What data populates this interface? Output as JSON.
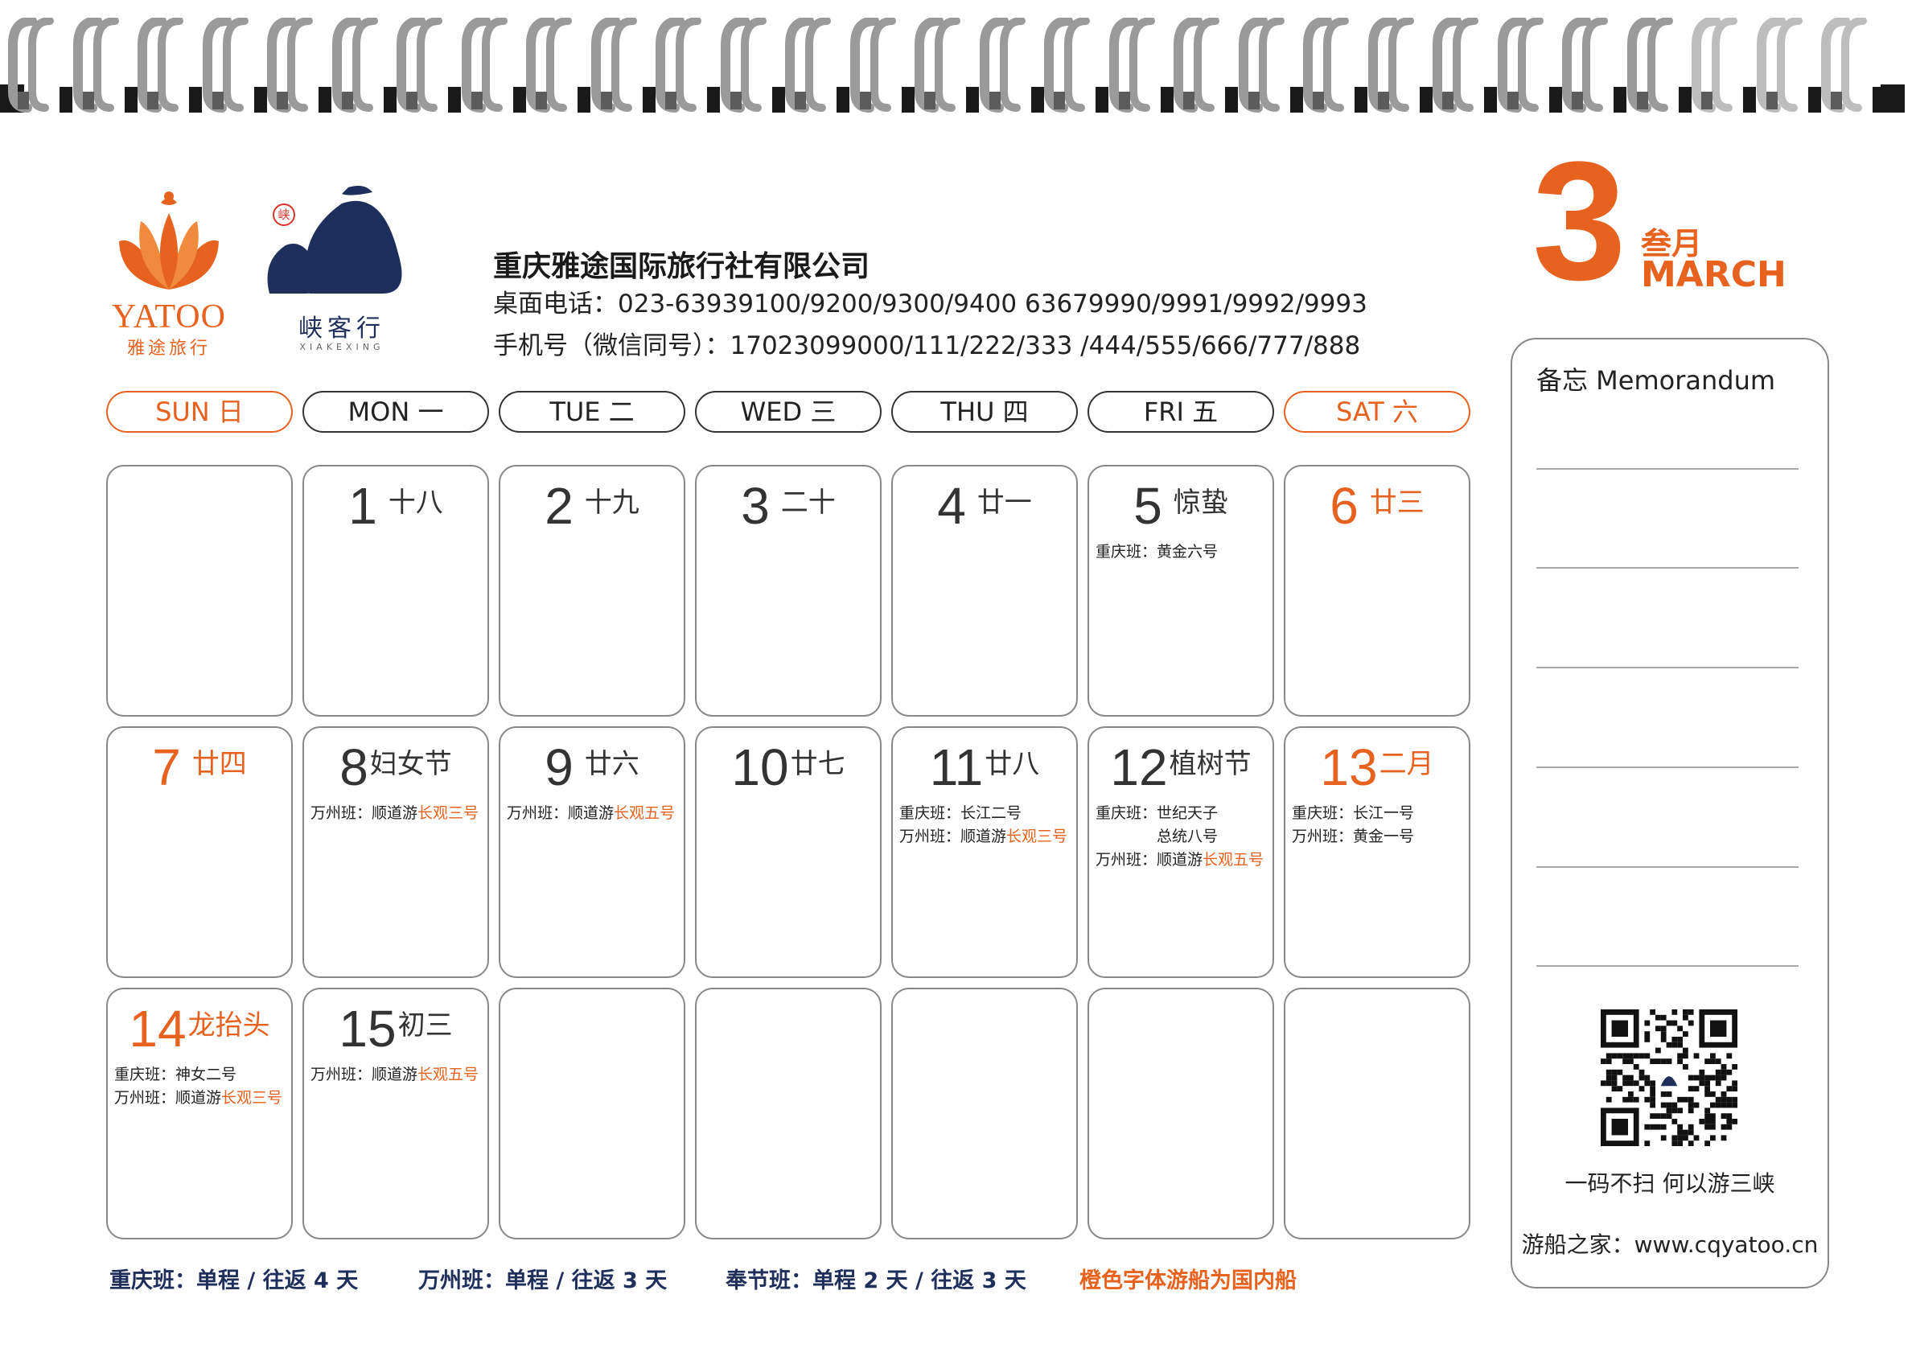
{
  "company": {
    "name": "重庆雅途国际旅行社有限公司",
    "desk_phone": "桌面电话：023-63939100/9200/9300/9400   63679990/9991/9992/9993",
    "mobile": "手机号（微信同号）：17023099000/111/222/333 /444/555/666/777/888"
  },
  "logos": {
    "yatoo_word": "YATOO",
    "yatoo_cn": "雅途旅行",
    "xk_seal": "峡",
    "xk_cn": "峡客行",
    "xk_pinyin": "XIAKEXING"
  },
  "month": {
    "number": "3",
    "cn": "叁月",
    "en": "MARCH"
  },
  "weekdays": [
    "SUN  日",
    "MON  一",
    "TUE  二",
    "WED  三",
    "THU  四",
    "FRI  五",
    "SAT 六"
  ],
  "days": [
    {
      "num": "",
      "lunar": "",
      "notes": []
    },
    {
      "num": "1",
      "lunar": "十八",
      "notes": []
    },
    {
      "num": "2",
      "lunar": "十九",
      "notes": []
    },
    {
      "num": "3",
      "lunar": "二十",
      "notes": []
    },
    {
      "num": "4",
      "lunar": "廿一",
      "notes": []
    },
    {
      "num": "5",
      "lunar": "惊蛰",
      "notes": [
        {
          "a": "重庆班：黄金六号",
          "b": ""
        }
      ]
    },
    {
      "num": "6",
      "lunar": "廿三",
      "notes": []
    },
    {
      "num": "7",
      "lunar": "廿四",
      "notes": []
    },
    {
      "num": "8",
      "lunar": "妇女节",
      "notes": [
        {
          "a": "万州班：顺道游",
          "b": "长观三号"
        }
      ]
    },
    {
      "num": "9",
      "lunar": "廿六",
      "notes": [
        {
          "a": "万州班：顺道游",
          "b": "长观五号"
        }
      ]
    },
    {
      "num": "10",
      "lunar": "廿七",
      "notes": []
    },
    {
      "num": "11",
      "lunar": "廿八",
      "notes": [
        {
          "a": "重庆班：长江二号",
          "b": ""
        },
        {
          "a": "万州班：顺道游",
          "b": "长观三号"
        }
      ]
    },
    {
      "num": "12",
      "lunar": "植树节",
      "notes": [
        {
          "a": "重庆班：世纪天子",
          "b": ""
        },
        {
          "a": "　　　　总统八号",
          "b": ""
        },
        {
          "a": "万州班：顺道游",
          "b": "长观五号"
        }
      ]
    },
    {
      "num": "13",
      "lunar": "二月",
      "notes": [
        {
          "a": "重庆班：长江一号",
          "b": ""
        },
        {
          "a": "万州班：黄金一号",
          "b": ""
        }
      ]
    },
    {
      "num": "14",
      "lunar": "龙抬头",
      "notes": [
        {
          "a": "重庆班：神女二号",
          "b": ""
        },
        {
          "a": "万州班：顺道游",
          "b": "长观三号"
        }
      ]
    },
    {
      "num": "15",
      "lunar": "初三",
      "notes": [
        {
          "a": "万州班：顺道游",
          "b": "长观五号"
        }
      ]
    },
    {
      "num": "",
      "lunar": "",
      "notes": []
    },
    {
      "num": "",
      "lunar": "",
      "notes": []
    },
    {
      "num": "",
      "lunar": "",
      "notes": []
    },
    {
      "num": "",
      "lunar": "",
      "notes": []
    },
    {
      "num": "",
      "lunar": "",
      "notes": []
    }
  ],
  "memo": {
    "title": "备忘  Memorandum",
    "slogan": "一码不扫   何以游三峡",
    "website": "游船之家：www.cqyatoo.cn"
  },
  "footer": {
    "chongqing": "重庆班：单程 / 往返 4 天",
    "wanzhou": "万州班：单程 / 往返 3 天",
    "fengjie": "奉节班：单程 2 天 / 往返 3 天",
    "note": "橙色字体游船为国内船"
  },
  "colors": {
    "accent": "#e8621f",
    "navy": "#1f2f5c",
    "border": "#888888"
  }
}
